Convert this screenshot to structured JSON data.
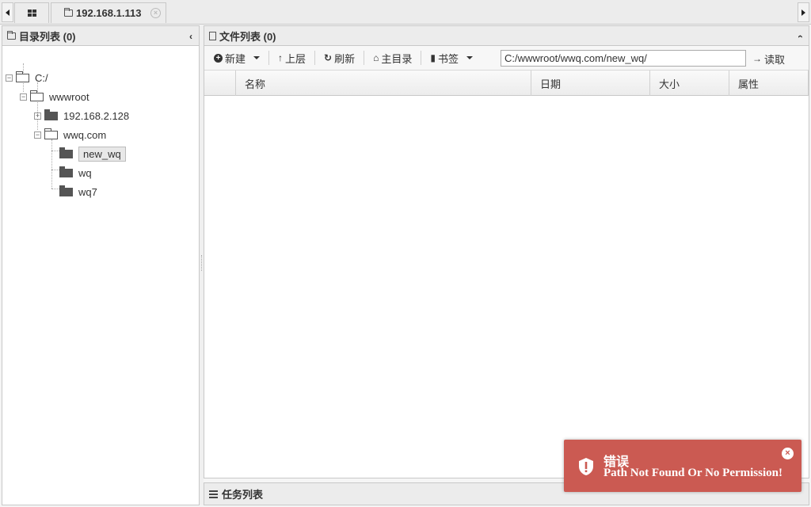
{
  "tabs": {
    "home_icon": "grid-icon",
    "host_tab": {
      "label": "192.168.1.113",
      "icon": "folder-icon",
      "close_icon": "close-icon"
    }
  },
  "left_panel": {
    "title": "目录列表 (0)",
    "collapse_icon": "chevron-left-icon",
    "tree": [
      {
        "label": "C:/",
        "expander": "−",
        "icon": "folder-open-icon"
      },
      {
        "label": "wwwroot",
        "expander": "−",
        "icon": "folder-open-icon"
      },
      {
        "label": "192.168.2.128",
        "expander": "+",
        "icon": "folder-closed-icon"
      },
      {
        "label": "wwq.com",
        "expander": "−",
        "icon": "folder-open-icon"
      },
      {
        "label": "new_wq",
        "icon": "folder-closed-icon",
        "selected": true
      },
      {
        "label": "wq",
        "icon": "folder-closed-icon"
      },
      {
        "label": "wq7",
        "icon": "folder-closed-icon"
      }
    ]
  },
  "right_panel": {
    "title": "文件列表 (0)",
    "collapse_icon": "chevron-up-icon",
    "toolbar": {
      "new_label": "新建",
      "up_label": "上层",
      "refresh_label": "刷新",
      "home_label": "主目录",
      "bookmark_label": "书签",
      "path_value": "C:/wwwroot/wwq.com/new_wq/",
      "read_label": "读取"
    },
    "columns": [
      "名称",
      "日期",
      "大小",
      "属性"
    ]
  },
  "task_panel": {
    "title": "任务列表"
  },
  "toast": {
    "title": "错误",
    "message": "Path Not Found Or No Permission!",
    "color": "#cb5a52"
  }
}
